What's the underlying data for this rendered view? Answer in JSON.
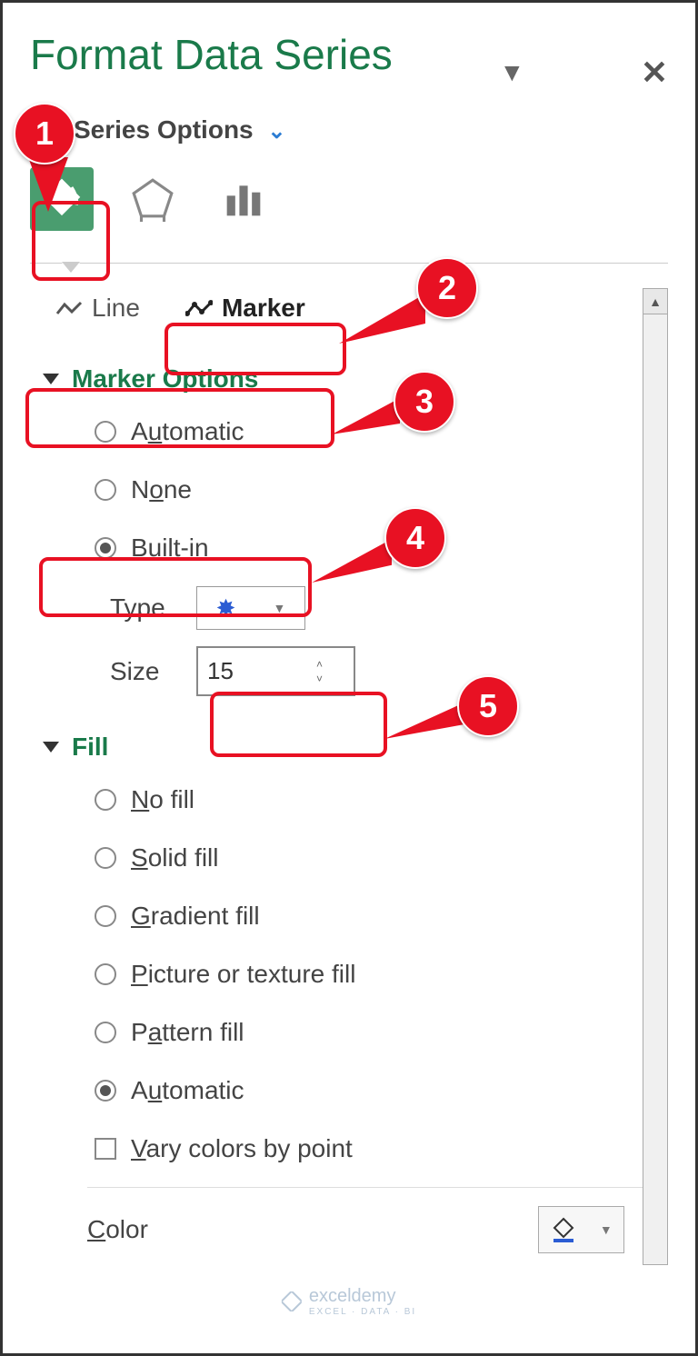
{
  "title": "Format Data Series",
  "series_options_label": "Series Options",
  "tabs": {
    "line": "Line",
    "marker": "Marker"
  },
  "marker_options": {
    "header": "Marker Options",
    "automatic": "Automatic",
    "none": "None",
    "builtin": "Built-in",
    "type_label": "Type",
    "size_label": "Size",
    "size_value": "15"
  },
  "fill": {
    "header": "Fill",
    "no_fill": "No fill",
    "solid": "Solid fill",
    "gradient": "Gradient fill",
    "picture": "Picture or texture fill",
    "pattern": "Pattern fill",
    "automatic": "Automatic",
    "vary": "Vary colors by point",
    "color": "Color"
  },
  "callouts": {
    "c1": "1",
    "c2": "2",
    "c3": "3",
    "c4": "4",
    "c5": "5"
  },
  "watermark": {
    "brand": "exceldemy",
    "sub": "EXCEL · DATA · BI"
  }
}
